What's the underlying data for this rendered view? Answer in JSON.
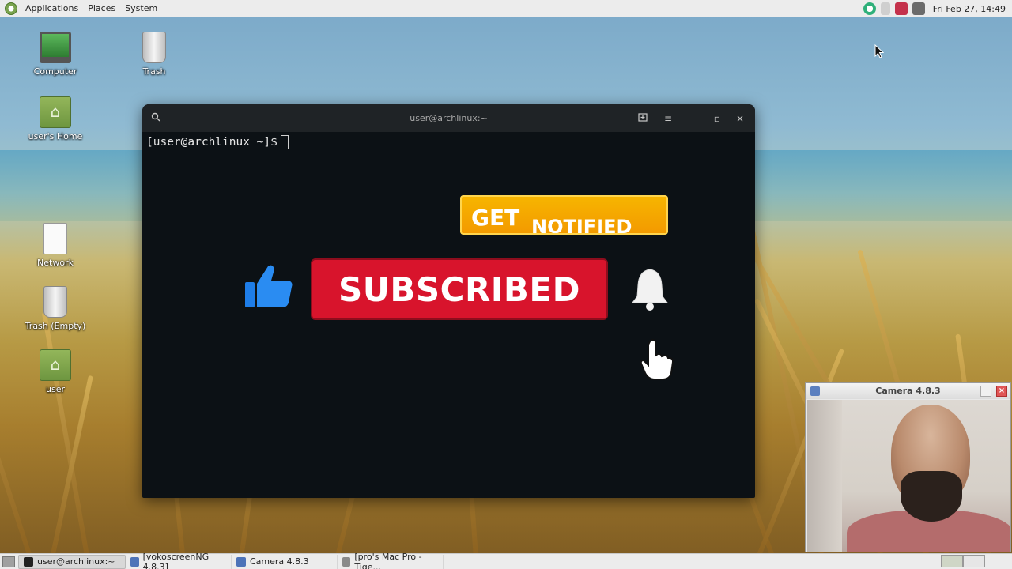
{
  "top_panel": {
    "menus": [
      "Applications",
      "Places",
      "System"
    ],
    "clock": "Fri Feb 27, 14:49"
  },
  "desktop_icons": [
    {
      "label": "Computer"
    },
    {
      "label": "Trash"
    },
    {
      "label": "user's Home"
    },
    {
      "label": "Network"
    },
    {
      "label": "Trash (Empty)"
    },
    {
      "label": "user"
    }
  ],
  "terminal": {
    "title": "user@archlinux:~",
    "prompt": "[user@archlinux ~]$"
  },
  "overlay": {
    "get_word": "GET",
    "notified_word": "NOTIFIED",
    "subscribed_label": "SUBSCRIBED",
    "colors": {
      "subscribe_red": "#d8142c",
      "notify_orange": "#f7a800",
      "thumb_blue": "#1e7de8"
    }
  },
  "camera_window": {
    "title": "Camera 4.8.3"
  },
  "taskbar": {
    "items": [
      {
        "label": "user@archlinux:~"
      },
      {
        "label": "[vokoscreenNG 4.8.3]"
      },
      {
        "label": "Camera 4.8.3"
      },
      {
        "label": "[pro's Mac Pro - Tige..."
      }
    ]
  }
}
